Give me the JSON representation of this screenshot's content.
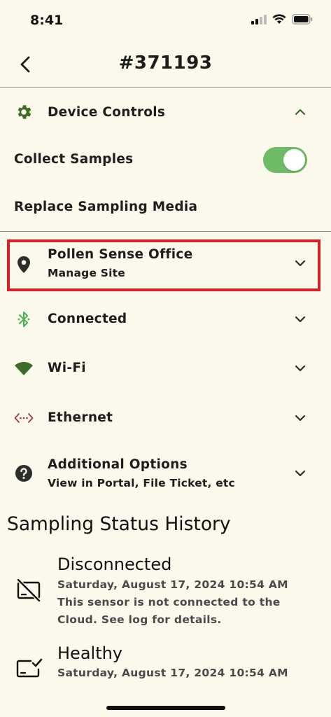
{
  "status_bar": {
    "time": "8:41"
  },
  "header": {
    "title": "#371193"
  },
  "device_controls": {
    "label": "Device Controls",
    "collect_samples": "Collect Samples",
    "collect_samples_on": true,
    "replace_media": "Replace Sampling Media"
  },
  "site": {
    "label": "Pollen Sense Office",
    "sub": "Manage Site"
  },
  "connection": {
    "label": "Connected"
  },
  "wifi": {
    "label": "Wi-Fi"
  },
  "ethernet": {
    "label": "Ethernet"
  },
  "additional": {
    "label": "Additional Options",
    "sub": "View in Portal, File Ticket, etc"
  },
  "history": {
    "title": "Sampling Status History",
    "items": [
      {
        "status": "Disconnected",
        "date": "Saturday, August 17, 2024 10:54 AM",
        "message": "This sensor is not connected to the Cloud. See log for details."
      },
      {
        "status": "Healthy",
        "date": "Saturday, August 17, 2024 10:54 AM"
      }
    ]
  },
  "colors": {
    "background": "#fbf8ec",
    "accent_green": "#3f6b2a",
    "toggle_green": "#6dbb66",
    "bluetooth_green": "#4caf50",
    "ethernet_red": "#a33a3a",
    "highlight_red": "#d8202a"
  },
  "icons": {
    "device_controls": "gear-icon",
    "site": "location-pin-icon",
    "connection": "bluetooth-icon",
    "wifi": "wifi-icon",
    "ethernet": "ethernet-icon",
    "additional": "help-circle-icon"
  }
}
